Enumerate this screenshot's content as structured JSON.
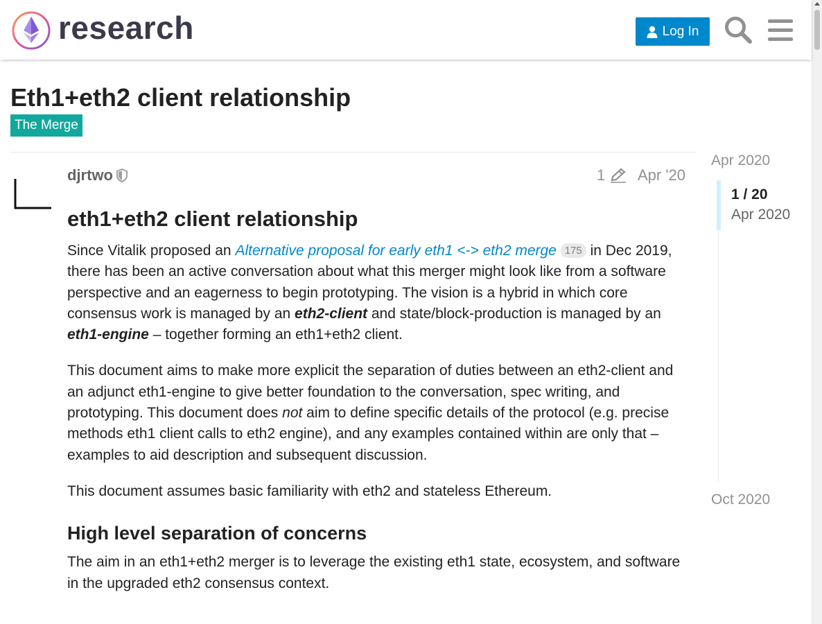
{
  "header": {
    "site_name": "research",
    "login_label": "Log In",
    "search_icon": "search-icon",
    "menu_icon": "hamburger-menu-icon",
    "brand_color": "#0088cc"
  },
  "topic": {
    "title": "Eth1+eth2 client relationship",
    "category": "The Merge",
    "category_color": "#12a89d"
  },
  "post": {
    "username": "djrtwo",
    "edit_count": "1",
    "date": "Apr '20",
    "heading": "eth1+eth2 client relationship",
    "p1": {
      "before": "Since Vitalik proposed an ",
      "link_text": "Alternative proposal for early eth1 <-> eth2 merge",
      "link_clicks": "175",
      "middle1": " in Dec 2019, there has been an active conversation about what this merger might look like from a software perspective and an eagerness to begin prototyping. The vision is a hybrid in which core consensus work is managed by an ",
      "term1": "eth2-client",
      "middle2": " and state/block-production is managed by an ",
      "term2": "eth1-engine",
      "after": " – together forming an eth1+eth2 client."
    },
    "p2": {
      "before": "This document aims to make more explicit the separation of duties between an eth2-client and an adjunct eth1-engine to give better foundation to the conversation, spec writing, and prototyping. This document does ",
      "emphasis": "not",
      "after": " aim to define specific details of the protocol (e.g. precise methods eth1 client calls to eth2 engine), and any examples contained within are only that – examples to aid description and subsequent discussion."
    },
    "p3": "This document assumes basic familiarity with eth2 and stateless Ethereum.",
    "section_heading": "High level separation of concerns",
    "p4": "The aim in an eth1+eth2 merger is to leverage the existing eth1 state, ecosystem, and software in the upgraded eth2 consensus context."
  },
  "timeline": {
    "start_label": "Apr 2020",
    "position": "1 / 20",
    "position_date": "Apr 2020",
    "end_label": "Oct 2020"
  }
}
